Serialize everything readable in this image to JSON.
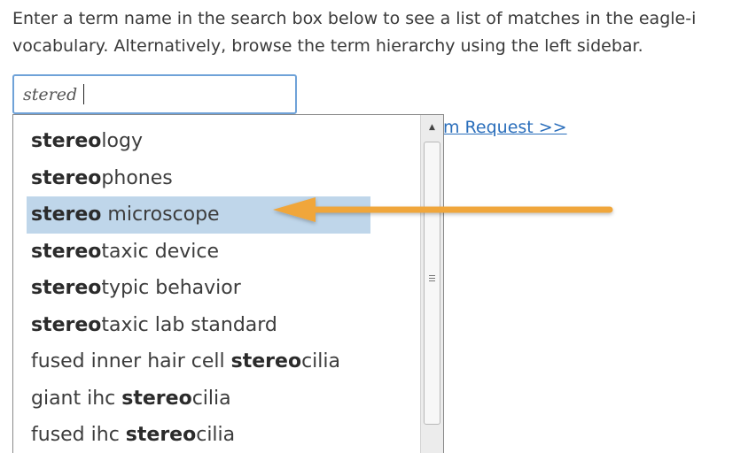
{
  "intro": {
    "line1": "Enter a term name in the search box below to see a list of matches in the eagle-i",
    "line2": "vocabulary. Alternatively, browse the term hierarchy using the left sidebar."
  },
  "search": {
    "value": "stered",
    "placeholder": ""
  },
  "request_link": "m Request >>",
  "suggestions": [
    {
      "pre": "",
      "match": "stereo",
      "post": "logy"
    },
    {
      "pre": "",
      "match": "stereo",
      "post": "phones"
    },
    {
      "pre": "",
      "match": "stereo",
      "post": " microscope"
    },
    {
      "pre": "",
      "match": "stereo",
      "post": "taxic device"
    },
    {
      "pre": "",
      "match": "stereo",
      "post": "typic behavior"
    },
    {
      "pre": "",
      "match": "stereo",
      "post": "taxic lab standard"
    },
    {
      "pre": "fused inner hair cell ",
      "match": "stereo",
      "post": "cilia"
    },
    {
      "pre": "giant ihc ",
      "match": "stereo",
      "post": "cilia"
    },
    {
      "pre": "fused ihc ",
      "match": "stereo",
      "post": "cilia"
    }
  ],
  "selected_index": 2,
  "colors": {
    "highlight": "#bfd6ea",
    "arrow": "#f0a63a",
    "link": "#2a6ebb",
    "input_border": "#6fa2d8"
  },
  "icons": {
    "scroll_up": "triangle-up",
    "scroll_grip": "grip-lines"
  }
}
